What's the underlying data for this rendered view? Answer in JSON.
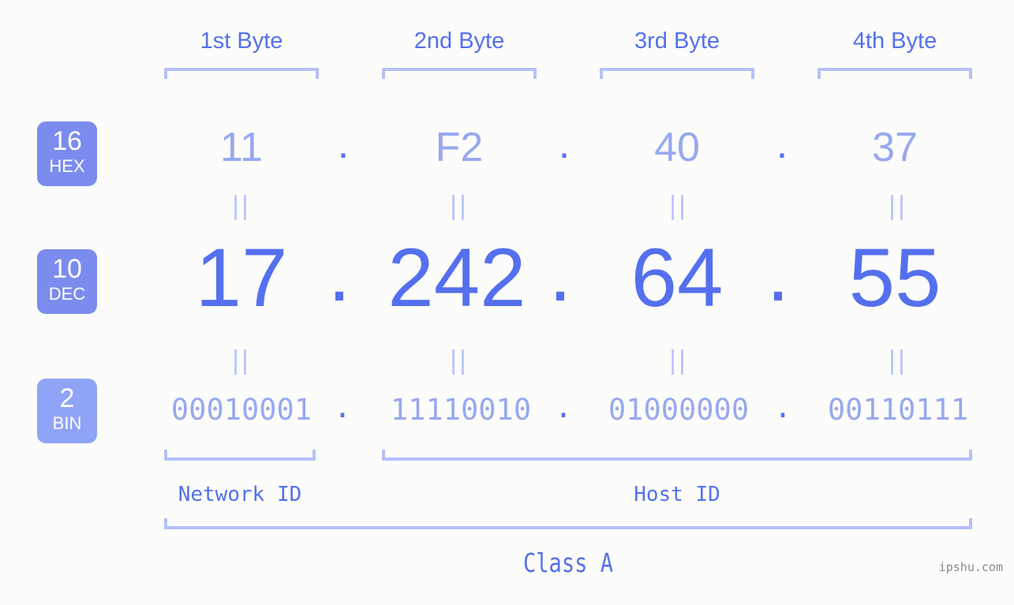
{
  "background_color": "#fcfdfa",
  "accent_color": "#5570ee",
  "accent_light_color": "#98a8f0",
  "bracket_color": "#b5c0fb",
  "badge_color": "#7b8cee",
  "headers": [
    {
      "label": "1st Byte"
    },
    {
      "label": "2nd Byte"
    },
    {
      "label": "3rd Byte"
    },
    {
      "label": "4th Byte"
    }
  ],
  "rows": {
    "hex": {
      "badge_number": "16",
      "badge_name": "HEX",
      "values": [
        "11",
        "F2",
        "40",
        "37"
      ],
      "separator": "."
    },
    "dec": {
      "badge_number": "10",
      "badge_name": "DEC",
      "values": [
        "17",
        "242",
        "64",
        "55"
      ],
      "separator": "."
    },
    "bin": {
      "badge_number": "2",
      "badge_name": "BIN",
      "values": [
        "00010001",
        "11110010",
        "01000000",
        "00110111"
      ],
      "separator": "."
    }
  },
  "equality_marks": [
    "||",
    "||",
    "||",
    "||",
    "||",
    "||",
    "||",
    "||"
  ],
  "segments": {
    "network_id": "Network ID",
    "host_id": "Host ID"
  },
  "class_label": "Class A",
  "watermark": "ipshu.com"
}
